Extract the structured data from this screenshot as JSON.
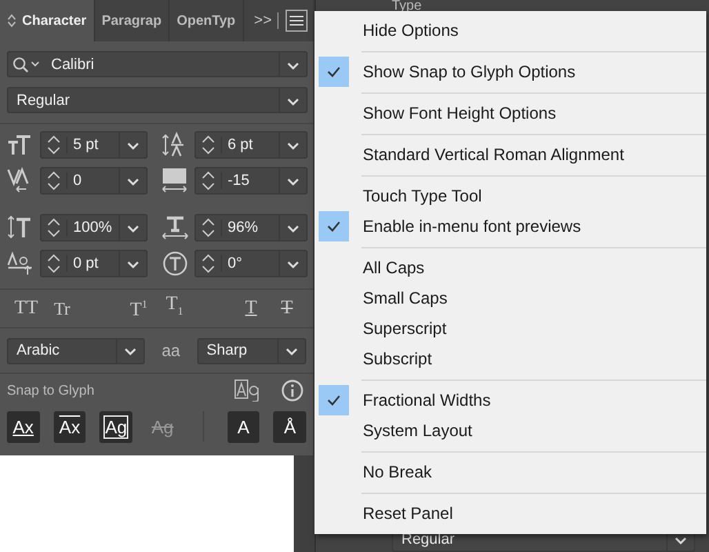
{
  "panel": {
    "tabs": [
      {
        "label": "Character",
        "selected": true
      },
      {
        "label": "Paragrap",
        "selected": false
      },
      {
        "label": "OpenTyp",
        "selected": false
      }
    ],
    "overflow": ">>",
    "font_family": "Calibri",
    "font_style": "Regular",
    "params": [
      {
        "kind": "font_size",
        "value": "5 pt"
      },
      {
        "kind": "leading",
        "value": "6 pt"
      },
      {
        "kind": "kerning",
        "value": "0"
      },
      {
        "kind": "tracking",
        "value": "-15"
      },
      {
        "kind": "vertical_scale",
        "value": "100%"
      },
      {
        "kind": "horizontal_scale",
        "value": "96%"
      },
      {
        "kind": "baseline_shift",
        "value": "0 pt"
      },
      {
        "kind": "rotation",
        "value": "0°"
      }
    ],
    "type_styles": [
      {
        "kind": "all_caps",
        "label": "TT"
      },
      {
        "kind": "small_caps",
        "label": "Tr"
      },
      {
        "kind": "superscript",
        "label": "T$^{1}$"
      },
      {
        "kind": "subscript",
        "label": "T$_{1}$"
      },
      {
        "kind": "underline",
        "label": "T"
      },
      {
        "kind": "strikethrough",
        "label": "T"
      }
    ],
    "language": "Arabic",
    "antialias_label": "aa",
    "antialias": "Sharp",
    "snap_title": "Snap to Glyph",
    "snap_buttons": [
      {
        "label": "Ax",
        "kind": "baseline",
        "disabled": false
      },
      {
        "label": "Ax",
        "kind": "xheight",
        "disabled": false
      },
      {
        "label": "Ag",
        "kind": "bounds",
        "disabled": false
      },
      {
        "label": "Ag",
        "kind": "proximity",
        "disabled": true
      },
      {
        "label": "A",
        "kind": "angular",
        "disabled": false
      },
      {
        "label": "Å",
        "kind": "anchor",
        "disabled": false
      }
    ]
  },
  "background": {
    "title": "Type",
    "style": "Regular"
  },
  "menu": {
    "groups": [
      {
        "items": [
          {
            "label": "Hide Options",
            "checked": false
          }
        ]
      },
      {
        "items": [
          {
            "label": "Show Snap to Glyph Options",
            "checked": true
          }
        ]
      },
      {
        "items": [
          {
            "label": "Show Font Height Options",
            "checked": false
          }
        ]
      },
      {
        "items": [
          {
            "label": "Standard Vertical Roman Alignment",
            "checked": false
          }
        ]
      },
      {
        "items": [
          {
            "label": "Touch Type Tool",
            "checked": false
          },
          {
            "label": "Enable in-menu font previews",
            "checked": true
          }
        ]
      },
      {
        "items": [
          {
            "label": "All Caps",
            "checked": false
          },
          {
            "label": "Small Caps",
            "checked": false
          },
          {
            "label": "Superscript",
            "checked": false
          },
          {
            "label": "Subscript",
            "checked": false
          }
        ]
      },
      {
        "items": [
          {
            "label": "Fractional Widths",
            "checked": true
          },
          {
            "label": "System Layout",
            "checked": false
          }
        ]
      },
      {
        "items": [
          {
            "label": "No Break",
            "checked": false
          }
        ]
      },
      {
        "items": [
          {
            "label": "Reset Panel",
            "checked": false
          }
        ]
      }
    ]
  }
}
